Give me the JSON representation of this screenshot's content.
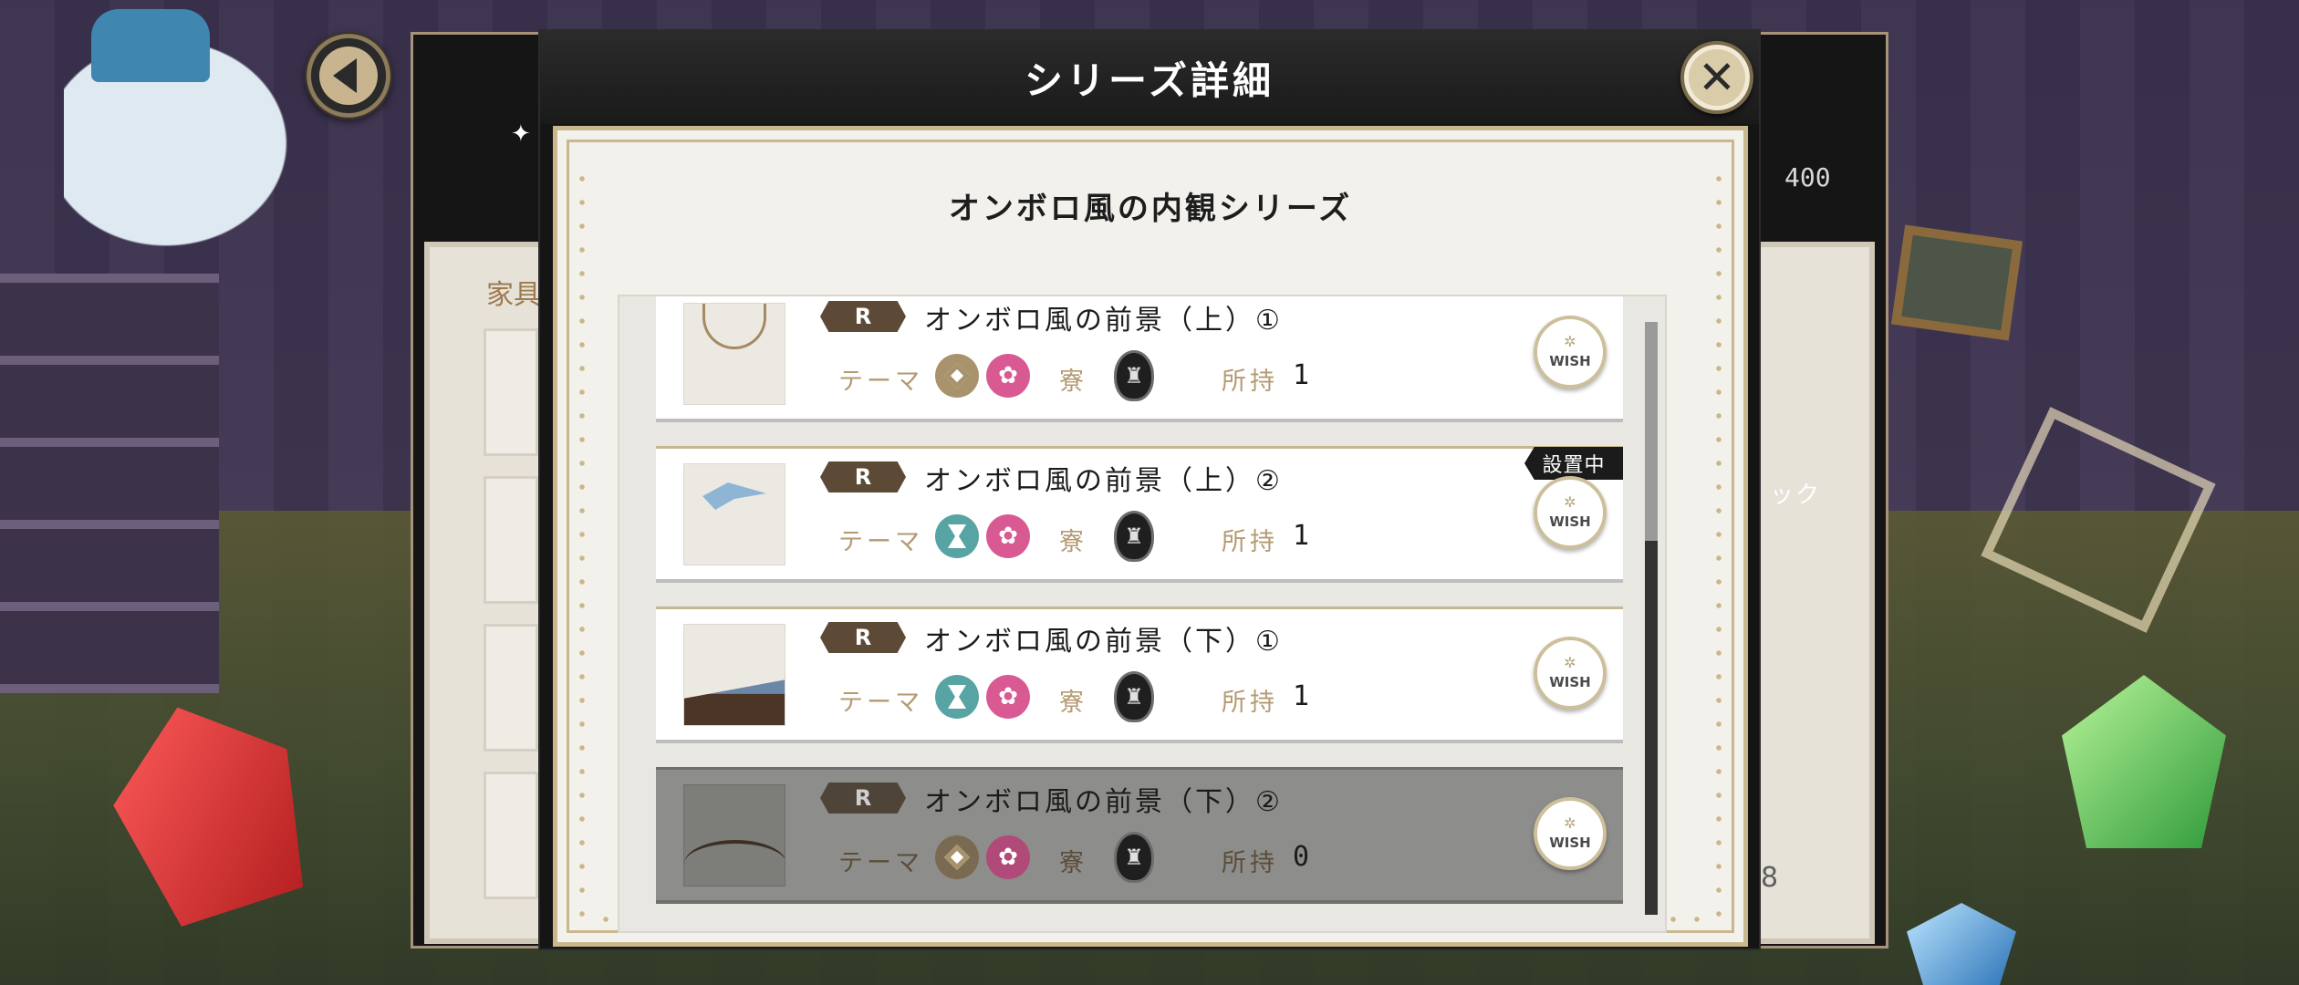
{
  "background": {
    "under_panel_left_label": "家具",
    "under_panel_right_label": "ック",
    "under_panel_count": "400",
    "under_panel_stub_count": "8"
  },
  "modal": {
    "title": "シリーズ詳細",
    "close_symbol": "✕",
    "series_title": "オンボロ風の内観シリーズ",
    "labels": {
      "theme": "テーマ",
      "dorm": "寮",
      "owned": "所持",
      "wish": "WISH",
      "installed": "設置中"
    },
    "items": [
      {
        "rarity": "R",
        "name": "オンボロ風の前景（上）①",
        "theme_icons": [
          "diamond-icon",
          "flower-icon"
        ],
        "owned": "1",
        "installed": false,
        "dimmed": false,
        "thumb": "chandelier"
      },
      {
        "rarity": "R",
        "name": "オンボロ風の前景（上）②",
        "theme_icons": [
          "hourglass-icon",
          "flower-icon"
        ],
        "owned": "1",
        "installed": true,
        "dimmed": false,
        "thumb": "bird"
      },
      {
        "rarity": "R",
        "name": "オンボロ風の前景（下）①",
        "theme_icons": [
          "hourglass-icon",
          "flower-icon"
        ],
        "owned": "1",
        "installed": false,
        "dimmed": false,
        "thumb": "bench"
      },
      {
        "rarity": "R",
        "name": "オンボロ風の前景（下）②",
        "theme_icons": [
          "diamond-icon",
          "flower-icon"
        ],
        "owned": "0",
        "installed": false,
        "dimmed": true,
        "thumb": "bridge"
      }
    ]
  },
  "colors": {
    "accent_gold": "#c8b88c",
    "rarity_brown": "#5c4a37",
    "theme_pink": "#d95a93",
    "theme_teal": "#58a3a3",
    "theme_gold": "#a8936c"
  }
}
